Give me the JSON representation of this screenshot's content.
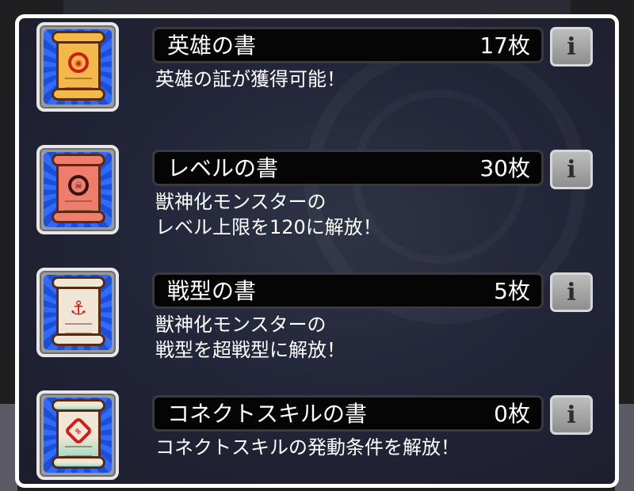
{
  "items": [
    {
      "title": "英雄の書",
      "count": "17枚",
      "description": "英雄の証が獲得可能！",
      "info_label": "i",
      "scroll_color": "#f2b84a",
      "emblem_color": "#d21b1b",
      "emblem_icon": "crest-icon"
    },
    {
      "title": "レベルの書",
      "count": "30枚",
      "description": "獣神化モンスターの\nレベル上限を120に解放！",
      "info_label": "i",
      "scroll_color": "#ef7d6e",
      "emblem_color": "#3a1010",
      "emblem_icon": "skull-icon"
    },
    {
      "title": "戦型の書",
      "count": "5枚",
      "description": "獣神化モンスターの\n戦型を超戦型に解放！",
      "info_label": "i",
      "scroll_color": "#efe6d6",
      "emblem_color": "#d21b1b",
      "emblem_icon": "anchor-icon"
    },
    {
      "title": "コネクトスキルの書",
      "count": "0枚",
      "description": "コネクトスキルの発動条件を解放！",
      "info_label": "i",
      "scroll_color": "#bfe8da",
      "emblem_color": "#d21b1b",
      "emblem_icon": "link-icon"
    }
  ]
}
